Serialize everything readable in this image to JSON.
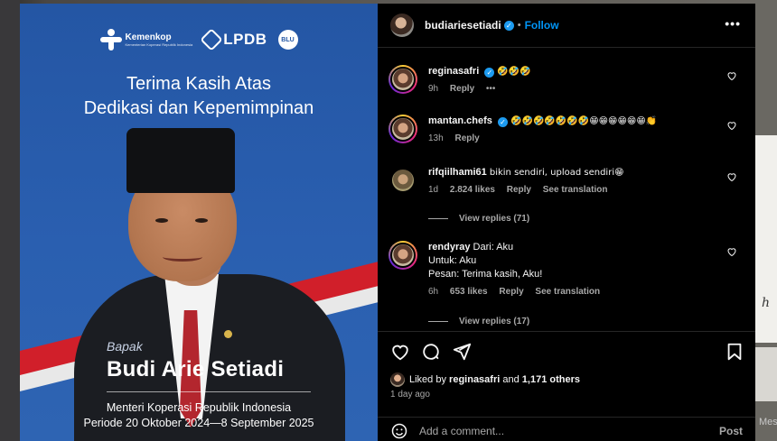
{
  "post_image": {
    "logos": {
      "kemenkop": "Kemenkop",
      "kemenkop_sub": "Kementerian Koperasi Republik Indonesia",
      "lpdb": "LPDB",
      "blu": "BLU"
    },
    "headline_line1": "Terima Kasih Atas",
    "headline_line2": "Dedikasi dan Kepemimpinan",
    "honorific": "Bapak",
    "name": "Budi Arie Setiadi",
    "role": "Menteri Koperasi Republik Indonesia",
    "period": "Periode 20 Oktober 2024—8 September 2025"
  },
  "header": {
    "username": "budiariesetiadi",
    "separator": "•",
    "follow_label": "Follow",
    "more": "•••"
  },
  "comments": [
    {
      "username": "reginasafri",
      "verified": true,
      "text": "🤣🤣🤣",
      "time": "9h",
      "reply": "Reply",
      "more": "•••"
    },
    {
      "username": "mantan.chefs",
      "verified": true,
      "text": "🤣🤣🤣🤣🤣🤣🤣😁😁😁😁😁😁👏",
      "time": "13h",
      "reply": "Reply"
    },
    {
      "username": "rifqiilhami61",
      "text": "bikin sendiri, upload sendiri😁",
      "time": "1d",
      "likes": "2.824 likes",
      "reply": "Reply",
      "translate": "See translation",
      "view_replies": "View replies (71)"
    },
    {
      "username": "rendyray",
      "text_line1": "Dari: Aku",
      "text_line2": "Untuk: Aku",
      "text_line3": "Pesan: Terima kasih, Aku!",
      "time": "6h",
      "likes": "653 likes",
      "reply": "Reply",
      "translate": "See translation",
      "view_replies": "View replies (17)"
    }
  ],
  "likes_bar": {
    "liked_by": "Liked by",
    "user": "reginasafri",
    "and": "and",
    "others": "1,171 others",
    "time_ago": "1 day ago"
  },
  "add_comment": {
    "placeholder": "Add a comment...",
    "post_label": "Post"
  },
  "background": {
    "right_text": "Mess"
  },
  "colors": {
    "accent": "#0095f6",
    "panel_bg": "#000000",
    "post_blue": "#2a5fb0",
    "flag_red": "#d11f2a"
  }
}
